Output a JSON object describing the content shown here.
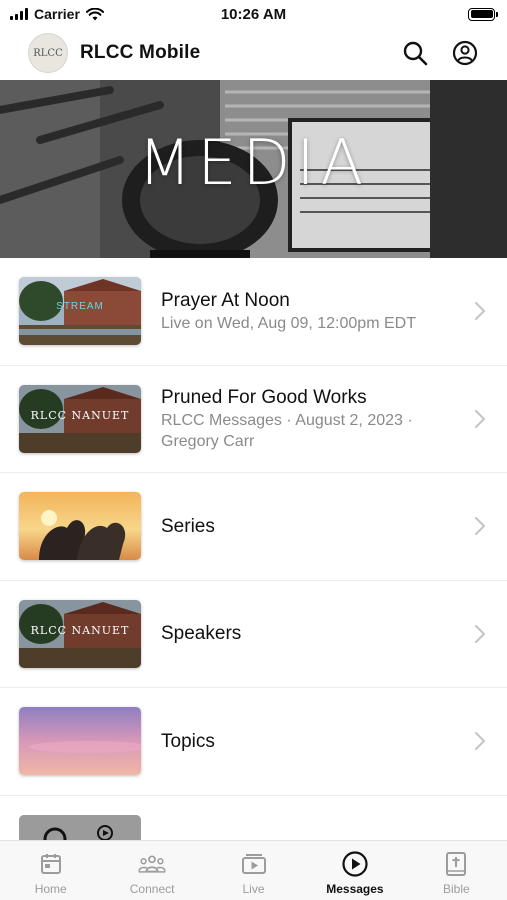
{
  "status_bar": {
    "carrier": "Carrier",
    "time": "10:26 AM"
  },
  "header": {
    "title": "RLCC Mobile",
    "logo_text": "RLCC"
  },
  "hero": {
    "title": "MEDIA"
  },
  "items": [
    {
      "title": "Prayer At Noon",
      "subtitle": "Live on Wed, Aug 09, 12:00pm EDT",
      "thumb_caption": "STREAM",
      "thumb": "church-building"
    },
    {
      "title": "Pruned For Good Works",
      "subtitle": "RLCC Messages · August 2, 2023 · Gregory Carr",
      "thumb_caption": "RLCC NANUET",
      "thumb": "church-building"
    },
    {
      "title": "Series",
      "subtitle": "",
      "thumb_caption": "",
      "thumb": "sunset-hearts"
    },
    {
      "title": "Speakers",
      "subtitle": "",
      "thumb_caption": "RLCC NANUET",
      "thumb": "church-building"
    },
    {
      "title": "Topics",
      "subtitle": "",
      "thumb_caption": "",
      "thumb": "pink-sky"
    }
  ],
  "tabs": [
    {
      "label": "Home",
      "icon": "calendar-icon",
      "active": false
    },
    {
      "label": "Connect",
      "icon": "people-icon",
      "active": false
    },
    {
      "label": "Live",
      "icon": "video-icon",
      "active": false
    },
    {
      "label": "Messages",
      "icon": "play-circle-icon",
      "active": true
    },
    {
      "label": "Bible",
      "icon": "bible-icon",
      "active": false
    }
  ],
  "colors": {
    "tab_active": "#111111",
    "tab_inactive": "#9c9c9c",
    "subtitle": "#8a8a8a",
    "stream_caption": "#62d6e6"
  }
}
